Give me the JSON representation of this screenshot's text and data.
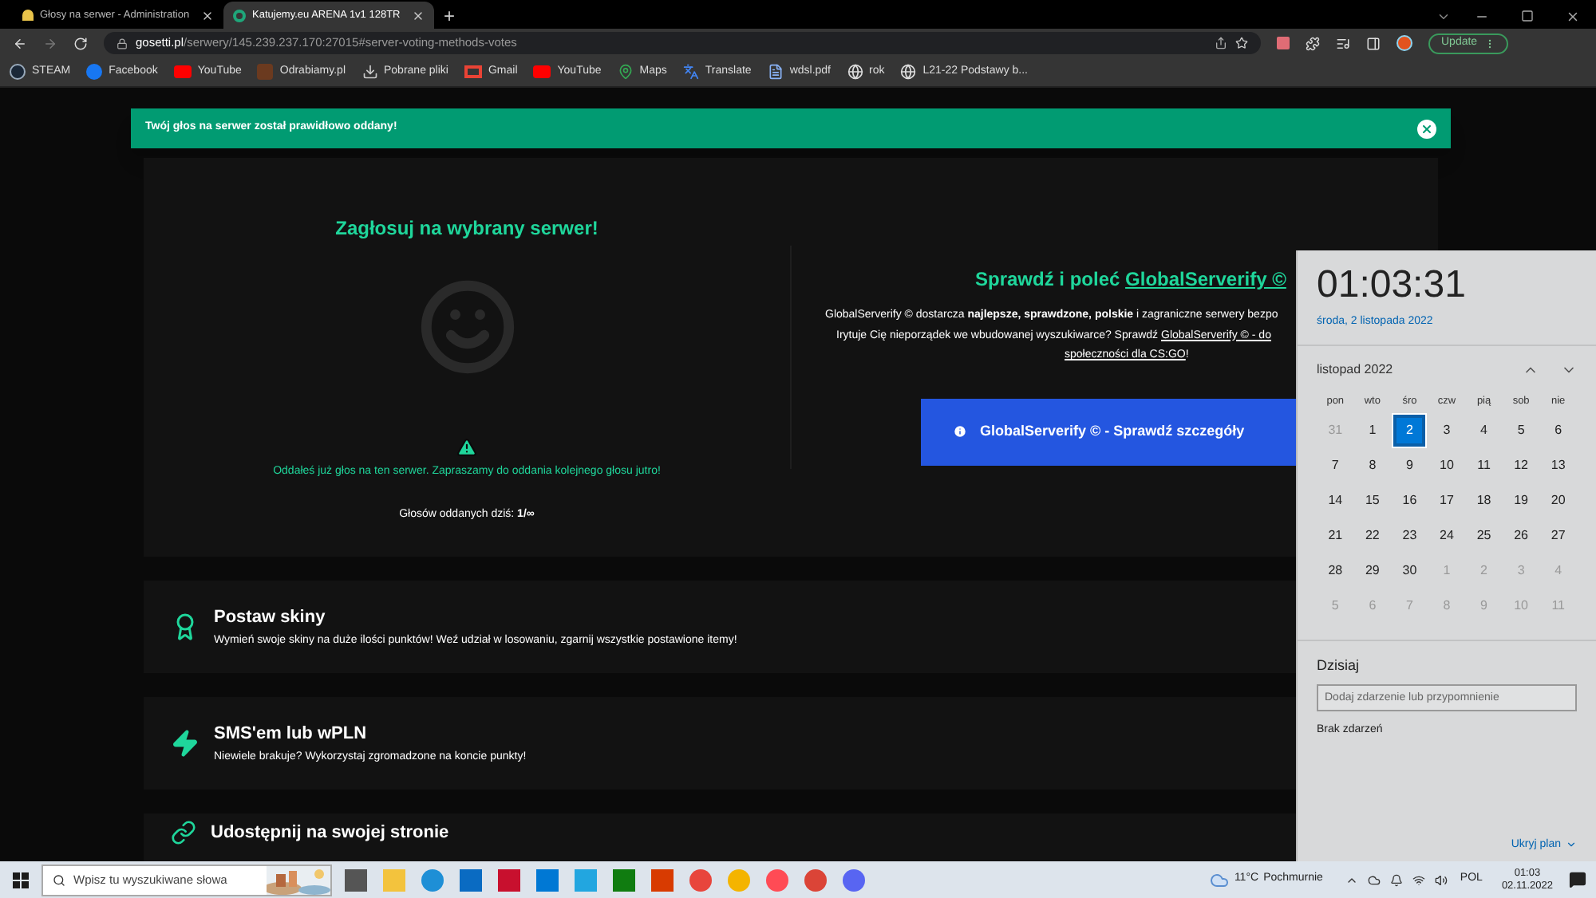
{
  "browser": {
    "tabs": [
      {
        "title": "Głosy na serwer - Administration",
        "selected": false
      },
      {
        "title": "Katujemy.eu ARENA 1v1 128TR",
        "selected": true
      }
    ],
    "new_tab": "+",
    "address": {
      "host": "gosetti.pl",
      "path": "/serwery/145.239.237.170:27015#server-voting-methods-votes"
    },
    "update_button": "Update",
    "bookmarks": [
      {
        "label": "STEAM",
        "kind": "steam"
      },
      {
        "label": "Facebook",
        "kind": "facebook"
      },
      {
        "label": "YouTube",
        "kind": "youtube"
      },
      {
        "label": "Odrabiamy.pl",
        "kind": "site"
      },
      {
        "label": "Pobrane pliki",
        "kind": "download"
      },
      {
        "label": "Gmail",
        "kind": "gmail"
      },
      {
        "label": "YouTube",
        "kind": "youtube"
      },
      {
        "label": "Maps",
        "kind": "maps"
      },
      {
        "label": "Translate",
        "kind": "translate"
      },
      {
        "label": "wdsl.pdf",
        "kind": "file"
      },
      {
        "label": "rok",
        "kind": "globe"
      },
      {
        "label": "L21-22 Podstawy b...",
        "kind": "globe"
      }
    ]
  },
  "page": {
    "alert": {
      "message": "Twój głos na serwer został prawidłowo oddany!"
    },
    "vote_panel": {
      "title": "Zagłosuj na wybrany serwer!",
      "warning": "Oddałeś już głos na ten serwer. Zapraszamy do oddania kolejnego głosu jutro!",
      "votes_today": "Głosów oddanych dziś: **1/∞**"
    },
    "promo": {
      "title": "Sprawdź i poleć",
      "title_link": "GlobalServerify ©",
      "line_1": "GlobalServerify © dostarcza **najlepsze, sprawdzone, polskie** i zagraniczne serwery bezpo",
      "line_2": "Irytuje Cię nieporządek we wbudowanej wyszukiwarce? Sprawdź",
      "line_2_link": "GlobalServerify © - do",
      "line_3_link": "społeczności dla CS:GO",
      "line_3_end": "!",
      "button": "GlobalServerify © - Sprawdź szczegóły"
    },
    "methods": [
      {
        "kind": "award",
        "title": "Postaw skiny",
        "description": "Wymień swoje skiny na duże ilości punktów! Weź udział w losowaniu, zgarnij wszystkie postawione itemy!"
      },
      {
        "kind": "bolt",
        "title": "SMS'em lub wPLN",
        "description": "Niewiele brakuje? Wykorzystaj zgromadzone na koncie punkty!"
      },
      {
        "kind": "link",
        "title": "Udostępnij na swojej stronie"
      }
    ]
  },
  "calendar": {
    "time": "01:03:31",
    "date": "środa, 2 listopada 2022",
    "month": "listopad 2022",
    "weekdays": [
      "pon",
      "wto",
      "śro",
      "czw",
      "pią",
      "sob",
      "nie"
    ],
    "days": [
      {
        "label": "31",
        "selected": false,
        "other_month": true
      },
      {
        "label": "1",
        "selected": false,
        "other_month": false
      },
      {
        "label": "2",
        "selected": true,
        "other_month": false
      },
      {
        "label": "3",
        "selected": false,
        "other_month": false
      },
      {
        "label": "4",
        "selected": false,
        "other_month": false
      },
      {
        "label": "5",
        "selected": false,
        "other_month": false
      },
      {
        "label": "6",
        "selected": false,
        "other_month": false
      },
      {
        "label": "7",
        "selected": false,
        "other_month": false
      },
      {
        "label": "8",
        "selected": false,
        "other_month": false
      },
      {
        "label": "9",
        "selected": false,
        "other_month": false
      },
      {
        "label": "10",
        "selected": false,
        "other_month": false
      },
      {
        "label": "11",
        "selected": false,
        "other_month": false
      },
      {
        "label": "12",
        "selected": false,
        "other_month": false
      },
      {
        "label": "13",
        "selected": false,
        "other_month": false
      },
      {
        "label": "14",
        "selected": false,
        "other_month": false
      },
      {
        "label": "15",
        "selected": false,
        "other_month": false
      },
      {
        "label": "16",
        "selected": false,
        "other_month": false
      },
      {
        "label": "17",
        "selected": false,
        "other_month": false
      },
      {
        "label": "18",
        "selected": false,
        "other_month": false
      },
      {
        "label": "19",
        "selected": false,
        "other_month": false
      },
      {
        "label": "20",
        "selected": false,
        "other_month": false
      },
      {
        "label": "21",
        "selected": false,
        "other_month": false
      },
      {
        "label": "22",
        "selected": false,
        "other_month": false
      },
      {
        "label": "23",
        "selected": false,
        "other_month": false
      },
      {
        "label": "24",
        "selected": false,
        "other_month": false
      },
      {
        "label": "25",
        "selected": false,
        "other_month": false
      },
      {
        "label": "26",
        "selected": false,
        "other_month": false
      },
      {
        "label": "27",
        "selected": false,
        "other_month": false
      },
      {
        "label": "28",
        "selected": false,
        "other_month": false
      },
      {
        "label": "29",
        "selected": false,
        "other_month": false
      },
      {
        "label": "30",
        "selected": false,
        "other_month": false
      },
      {
        "label": "1",
        "selected": false,
        "other_month": true
      },
      {
        "label": "2",
        "selected": false,
        "other_month": true
      },
      {
        "label": "3",
        "selected": false,
        "other_month": true
      },
      {
        "label": "4",
        "selected": false,
        "other_month": true
      },
      {
        "label": "5",
        "selected": false,
        "other_month": true
      },
      {
        "label": "6",
        "selected": false,
        "other_month": true
      },
      {
        "label": "7",
        "selected": false,
        "other_month": true
      },
      {
        "label": "8",
        "selected": false,
        "other_month": true
      },
      {
        "label": "9",
        "selected": false,
        "other_month": true
      },
      {
        "label": "10",
        "selected": false,
        "other_month": true
      },
      {
        "label": "11",
        "selected": false,
        "other_month": true
      }
    ],
    "today_heading": "Dzisiaj",
    "event_placeholder": "Dodaj zdarzenie lub przypomnienie",
    "no_events": "Brak zdarzeń",
    "hide_button": "Ukryj plan"
  },
  "taskbar": {
    "search_placeholder": "Wpisz tu wyszukiwane słowa",
    "temperature": "11°C",
    "weather": "Pochmurnie",
    "language": "POL",
    "time": "01:03",
    "date": "02.11.2022"
  }
}
